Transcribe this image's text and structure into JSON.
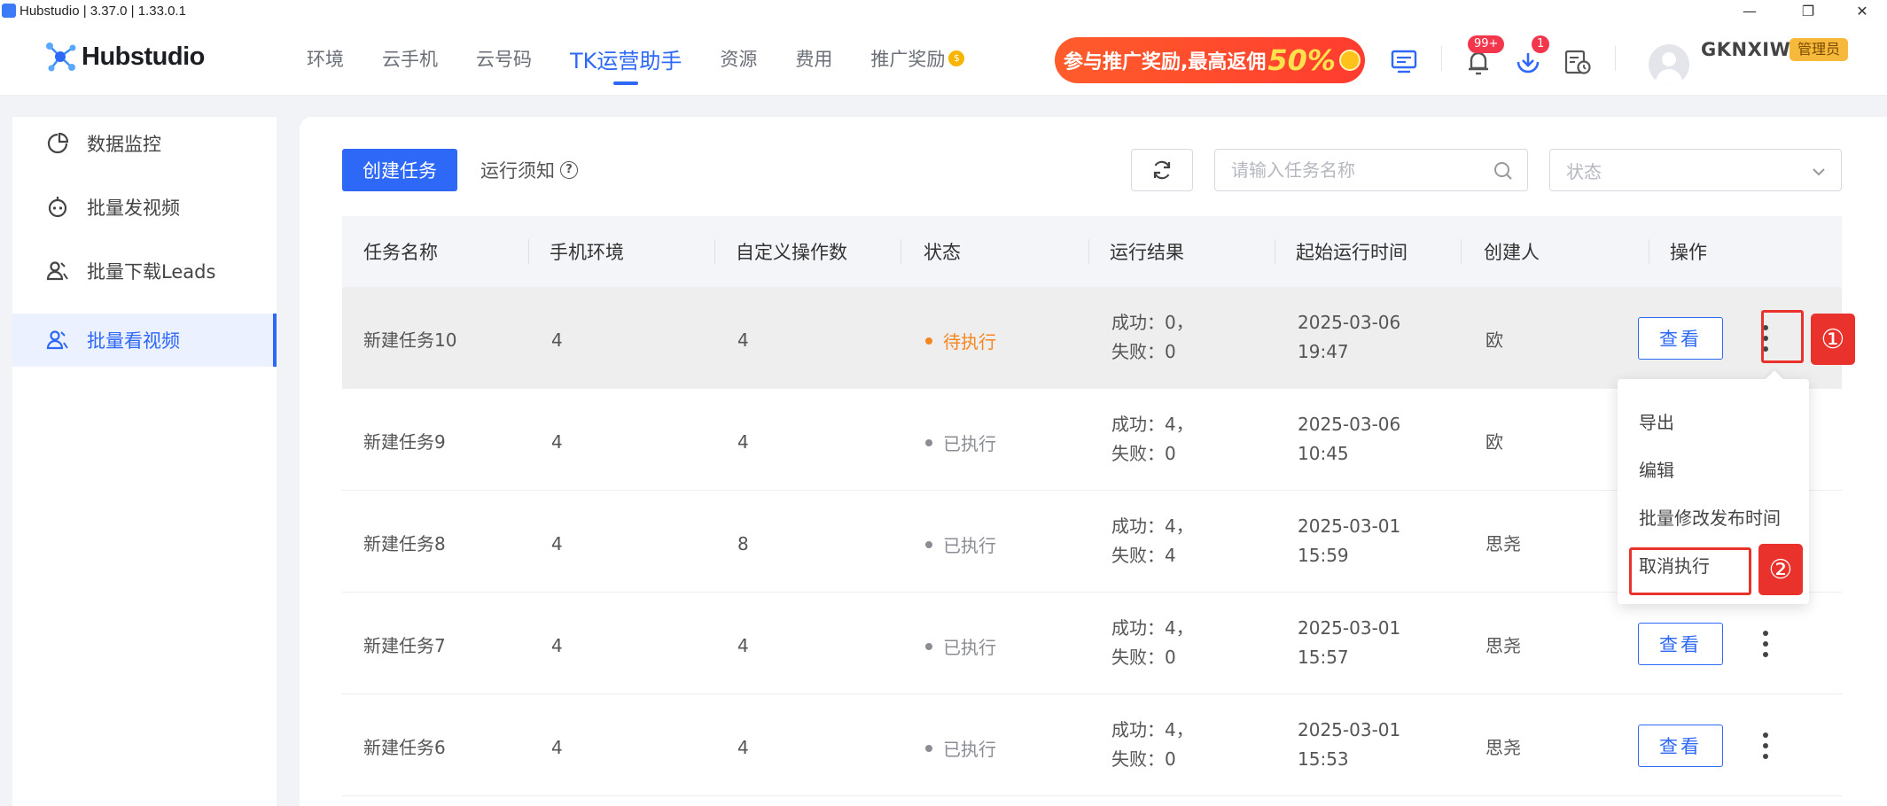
{
  "window": {
    "title": "Hubstudio | 3.37.0 | 1.33.0.1",
    "minimize": "—",
    "maximize": "❐",
    "close": "✕"
  },
  "header": {
    "logo_text": "Hubstudio",
    "nav": [
      {
        "label": "环境"
      },
      {
        "label": "云手机"
      },
      {
        "label": "云号码"
      },
      {
        "label": "TK运营助手",
        "active": true
      },
      {
        "label": "资源"
      },
      {
        "label": "费用"
      },
      {
        "label": "推广奖励"
      }
    ],
    "promo": {
      "text": "参与推广奖励,最高返佣",
      "percent": "50%"
    },
    "icons": [
      "screen-icon",
      "bell-icon",
      "download-icon",
      "schedule-icon"
    ],
    "notif_badge": "99+",
    "download_badge": "1",
    "user": {
      "name": "GKNXIW",
      "role": "管理员"
    }
  },
  "sidebar": {
    "items": [
      {
        "label": "数据监控",
        "icon": "chart-pie-icon"
      },
      {
        "label": "批量发视频",
        "icon": "robot-icon"
      },
      {
        "label": "批量下载Leads",
        "icon": "user-group-icon"
      },
      {
        "label": "批量看视频",
        "icon": "user-group-icon",
        "active": true
      }
    ]
  },
  "toolbar": {
    "create_label": "创建任务",
    "notice_label": "运行须知",
    "notice_icon": "?",
    "search_placeholder": "请输入任务名称",
    "status_placeholder": "状态"
  },
  "table": {
    "columns": [
      "任务名称",
      "手机环境",
      "自定义操作数",
      "状态",
      "运行结果",
      "起始运行时间",
      "创建人",
      "操作"
    ],
    "view_label": "查看",
    "rows": [
      {
        "name": "新建任务10",
        "env": "4",
        "ops": "4",
        "status": "待执行",
        "status_color": "#f5861f",
        "result_1": "成功：0，",
        "result_2": "失败：0",
        "date": "2025-03-06",
        "time": "19:47",
        "creator": "欧"
      },
      {
        "name": "新建任务9",
        "env": "4",
        "ops": "4",
        "status": "已执行",
        "status_color": "#8a8d94",
        "result_1": "成功：4，",
        "result_2": "失败：0",
        "date": "2025-03-06",
        "time": "10:45",
        "creator": "欧"
      },
      {
        "name": "新建任务8",
        "env": "4",
        "ops": "8",
        "status": "已执行",
        "status_color": "#8a8d94",
        "result_1": "成功：4，",
        "result_2": "失败：4",
        "date": "2025-03-01",
        "time": "15:59",
        "creator": "思尧"
      },
      {
        "name": "新建任务7",
        "env": "4",
        "ops": "4",
        "status": "已执行",
        "status_color": "#8a8d94",
        "result_1": "成功：4，",
        "result_2": "失败：0",
        "date": "2025-03-01",
        "time": "15:57",
        "creator": "思尧"
      },
      {
        "name": "新建任务6",
        "env": "4",
        "ops": "4",
        "status": "已执行",
        "status_color": "#8a8d94",
        "result_1": "成功：4，",
        "result_2": "失败：0",
        "date": "2025-03-01",
        "time": "15:53",
        "creator": "思尧"
      }
    ]
  },
  "menu": {
    "items": [
      "导出",
      "编辑",
      "批量修改发布时间",
      "取消执行"
    ]
  },
  "annotations": {
    "step1": "①",
    "step2": "②"
  },
  "colors": {
    "primary": "#2e68f6",
    "annotation": "#e8322b",
    "pending": "#f5861f",
    "done": "#8a8d94"
  }
}
